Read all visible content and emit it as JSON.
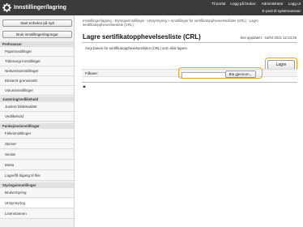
{
  "header": {
    "title": "Innstillinger/lagring",
    "links": [
      "Til portal",
      "Logg på brukar:",
      "Administrator",
      "Logg ut"
    ],
    "email": "E-post til systemansvar"
  },
  "sidebar": {
    "start_button": "Start enheten på nytt",
    "usage_button": "Bruk innstillinger/lagringar",
    "sections": [
      {
        "heading": "Preferanser",
        "items": [
          "Papirinnstillinger",
          "Tid/energi-innstillinger",
          "Nettverksinnstillinger",
          "Eksternt grensesnitt",
          "Voluminnstillinger"
        ]
      },
      {
        "heading": "Justering/vedlikehold",
        "items": [
          "Justere bildekvalitet",
          "Vedlikehold"
        ]
      },
      {
        "heading": "Funksjonsinnstillinger",
        "items": [
          "Felleinnstillinger",
          "Skriver",
          "Sende",
          "Motta",
          "Lagre/få tilgang til filer"
        ]
      },
      {
        "heading": "Styringsinnstillinger",
        "items": [
          "Brukerstyring",
          "Utstyrstyring",
          "Lisens/annen"
        ]
      }
    ]
  },
  "main": {
    "breadcrumb": "Innstillinger/lagring : Styringsinnstillinger : Utstyrstyring > Innstillinger for sertifikatoppheveelseslister (CRL) : Lagre sertifikatoppheveelsesliste (CRL)",
    "title": "Lagre sertifikatopphevelsesliste (CRL)",
    "last_updated": "Sist oppdatert : 15/04 2021 12:43:25",
    "description": "Angi banen for sertifikatopphevelseslisten (CRL) som skal lagres.",
    "save_label": "Lagre",
    "file_path_label": "Filbane:",
    "file_path_value": "",
    "browse_label": "Bla gjennom...",
    "top_label": "Til toppen"
  }
}
